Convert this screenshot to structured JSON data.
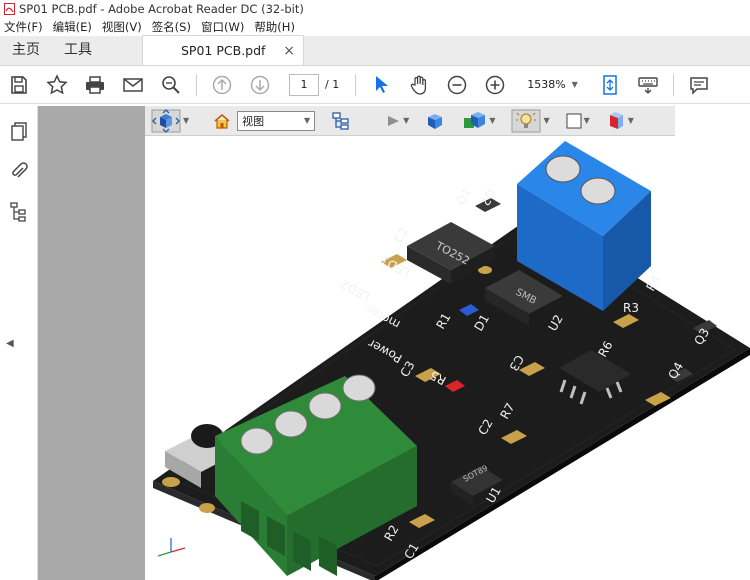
{
  "window": {
    "title": "SP01 PCB.pdf - Adobe Acrobat Reader DC (32-bit)"
  },
  "menu": [
    "文件(F)",
    "编辑(E)",
    "视图(V)",
    "签名(S)",
    "窗口(W)",
    "帮助(H)"
  ],
  "tabs": {
    "home": "主页",
    "tools": "工具",
    "document": "SP01 PCB.pdf",
    "close": "×"
  },
  "toolbar": {
    "page_current": "1",
    "page_total": "/ 1",
    "zoom": "1538%"
  },
  "toolbar3d": {
    "view_select": "视图"
  },
  "pcb_labels": {
    "q1": "Q1",
    "q2": "Q2",
    "q3": "Q3",
    "q4": "Q4",
    "r1": "R1",
    "r2": "R2",
    "r3": "R3",
    "r4": "R4",
    "r5": "R5",
    "r6": "R6",
    "r7": "R7",
    "c1": "C1",
    "c2": "C2",
    "c3": "C3",
    "u1": "U1",
    "u2": "U2",
    "d1": "D1",
    "led1": "LED1",
    "led2": "LED2",
    "motor": "motor",
    "power": "Power",
    "to252": "TO252",
    "smb": "SMB",
    "sot89": "SOT89"
  },
  "colors": {
    "connector_blue": "#1f74d6",
    "connector_green": "#2f8a3a",
    "board_black": "#141414",
    "accent_red": "#d7262b"
  }
}
